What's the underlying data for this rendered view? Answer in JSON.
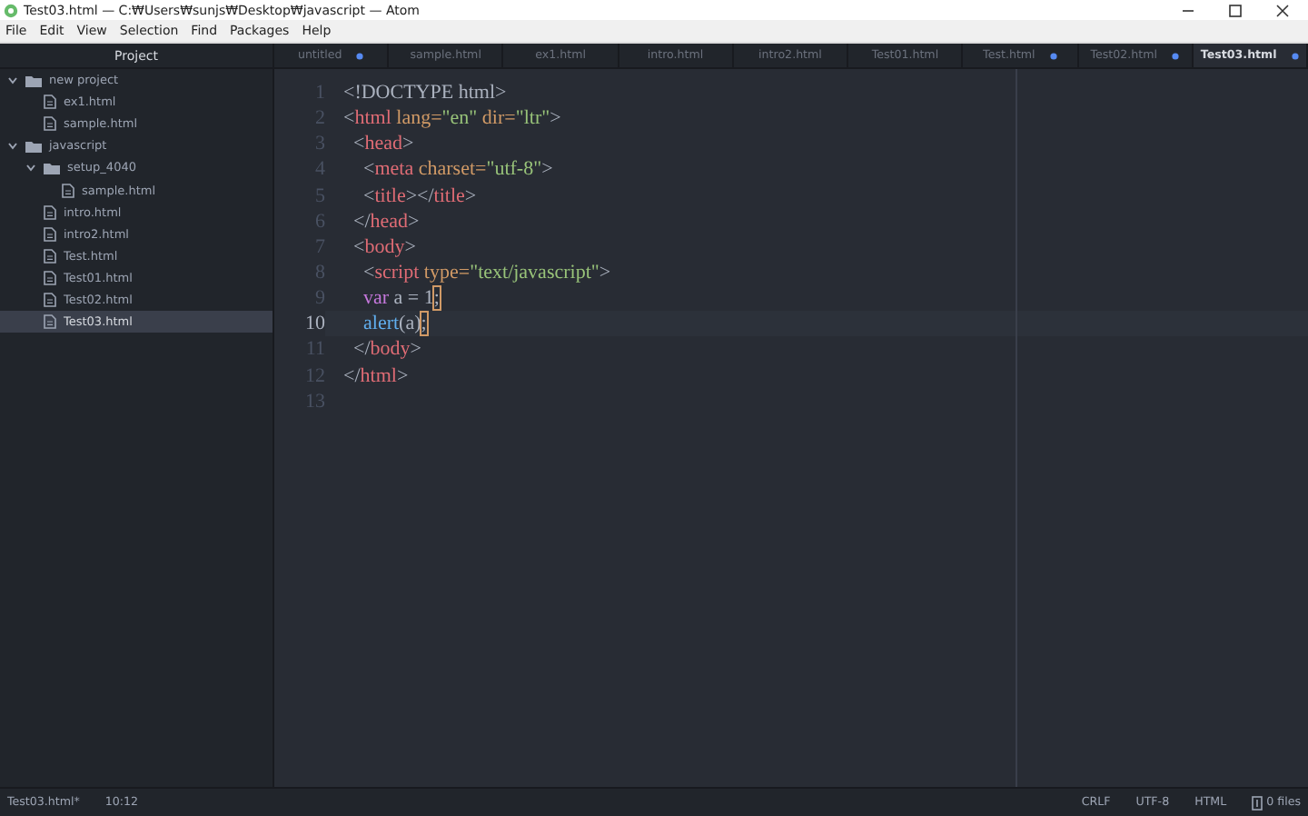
{
  "window": {
    "title": "Test03.html — C:₩Users₩sunjs₩Desktop₩javascript — Atom"
  },
  "menu": [
    "File",
    "Edit",
    "View",
    "Selection",
    "Find",
    "Packages",
    "Help"
  ],
  "sidebar": {
    "title": "Project",
    "tree": [
      {
        "label": "new project",
        "kind": "folder",
        "expanded": true,
        "selected": false,
        "children": [
          {
            "label": "ex1.html",
            "kind": "file",
            "selected": false
          },
          {
            "label": "sample.html",
            "kind": "file",
            "selected": false
          }
        ]
      },
      {
        "label": "javascript",
        "kind": "folder",
        "expanded": true,
        "selected": false,
        "children": [
          {
            "label": "setup_4040",
            "kind": "folder",
            "expanded": true,
            "selected": false,
            "children": [
              {
                "label": "sample.html",
                "kind": "file",
                "selected": false
              }
            ]
          },
          {
            "label": "intro.html",
            "kind": "file",
            "selected": false
          },
          {
            "label": "intro2.html",
            "kind": "file",
            "selected": false
          },
          {
            "label": "Test.html",
            "kind": "file",
            "selected": false
          },
          {
            "label": "Test01.html",
            "kind": "file",
            "selected": false
          },
          {
            "label": "Test02.html",
            "kind": "file",
            "selected": false
          },
          {
            "label": "Test03.html",
            "kind": "file",
            "selected": true
          }
        ]
      }
    ]
  },
  "tabs": [
    {
      "label": "untitled",
      "modified": true,
      "selected": false
    },
    {
      "label": "sample.html",
      "modified": false,
      "selected": false
    },
    {
      "label": "ex1.html",
      "modified": false,
      "selected": false
    },
    {
      "label": "intro.html",
      "modified": false,
      "selected": false
    },
    {
      "label": "intro2.html",
      "modified": false,
      "selected": false
    },
    {
      "label": "Test01.html",
      "modified": false,
      "selected": false
    },
    {
      "label": "Test.html",
      "modified": true,
      "selected": false
    },
    {
      "label": "Test02.html",
      "modified": true,
      "selected": false
    },
    {
      "label": "Test03.html",
      "modified": true,
      "selected": true
    }
  ],
  "editor": {
    "lines": [
      {
        "number": "1",
        "current": false,
        "tokens": [
          {
            "kind": "plain",
            "text": "<!DOCTYPE html>"
          }
        ]
      },
      {
        "number": "2",
        "current": false,
        "tokens": [
          {
            "kind": "punct",
            "text": "<"
          },
          {
            "kind": "tag",
            "text": "html"
          },
          {
            "kind": "attr",
            "text": " lang="
          },
          {
            "kind": "string",
            "text": "\"en\""
          },
          {
            "kind": "attr",
            "text": " dir="
          },
          {
            "kind": "string",
            "text": "\"ltr\""
          },
          {
            "kind": "punct",
            "text": ">"
          }
        ]
      },
      {
        "number": "3",
        "current": false,
        "tokens": [
          {
            "kind": "punct",
            "text": "  <"
          },
          {
            "kind": "tag",
            "text": "head"
          },
          {
            "kind": "punct",
            "text": ">"
          }
        ]
      },
      {
        "number": "4",
        "current": false,
        "tokens": [
          {
            "kind": "punct",
            "text": "    <"
          },
          {
            "kind": "tag",
            "text": "meta"
          },
          {
            "kind": "attr",
            "text": " charset="
          },
          {
            "kind": "string",
            "text": "\"utf-8\""
          },
          {
            "kind": "punct",
            "text": ">"
          }
        ]
      },
      {
        "number": "5",
        "current": false,
        "tokens": [
          {
            "kind": "punct",
            "text": "    <"
          },
          {
            "kind": "tag",
            "text": "title"
          },
          {
            "kind": "punct",
            "text": "></"
          },
          {
            "kind": "tag",
            "text": "title"
          },
          {
            "kind": "punct",
            "text": ">"
          }
        ]
      },
      {
        "number": "6",
        "current": false,
        "tokens": [
          {
            "kind": "punct",
            "text": "  </"
          },
          {
            "kind": "tag",
            "text": "head"
          },
          {
            "kind": "punct",
            "text": ">"
          }
        ]
      },
      {
        "number": "7",
        "current": false,
        "tokens": [
          {
            "kind": "punct",
            "text": "  <"
          },
          {
            "kind": "tag",
            "text": "body"
          },
          {
            "kind": "punct",
            "text": ">"
          }
        ]
      },
      {
        "number": "8",
        "current": false,
        "tokens": [
          {
            "kind": "punct",
            "text": "    <"
          },
          {
            "kind": "tag",
            "text": "script"
          },
          {
            "kind": "attr",
            "text": " type="
          },
          {
            "kind": "string",
            "text": "\"text/javascript\""
          },
          {
            "kind": "punct",
            "text": ">"
          }
        ]
      },
      {
        "number": "9",
        "current": false,
        "tokens": [
          {
            "kind": "keyword",
            "text": "    var"
          },
          {
            "kind": "plain",
            "text": " a = 1"
          },
          {
            "kind": "match",
            "text": ";"
          }
        ]
      },
      {
        "number": "10",
        "current": true,
        "tokens": [
          {
            "kind": "func",
            "text": "    alert"
          },
          {
            "kind": "plain",
            "text": "(a)"
          },
          {
            "kind": "match",
            "text": ";"
          }
        ]
      },
      {
        "number": "11",
        "current": false,
        "tokens": [
          {
            "kind": "punct",
            "text": "  </"
          },
          {
            "kind": "tag",
            "text": "body"
          },
          {
            "kind": "punct",
            "text": ">"
          }
        ]
      },
      {
        "number": "12",
        "current": false,
        "tokens": [
          {
            "kind": "punct",
            "text": "</"
          },
          {
            "kind": "tag",
            "text": "html"
          },
          {
            "kind": "punct",
            "text": ">"
          }
        ]
      },
      {
        "number": "13",
        "current": false
      }
    ]
  },
  "status_bar": {
    "file": "Test03.html*",
    "cursor": "10:12",
    "line_ending": "CRLF",
    "encoding": "UTF-8",
    "grammar": "HTML",
    "git": "0 files"
  }
}
